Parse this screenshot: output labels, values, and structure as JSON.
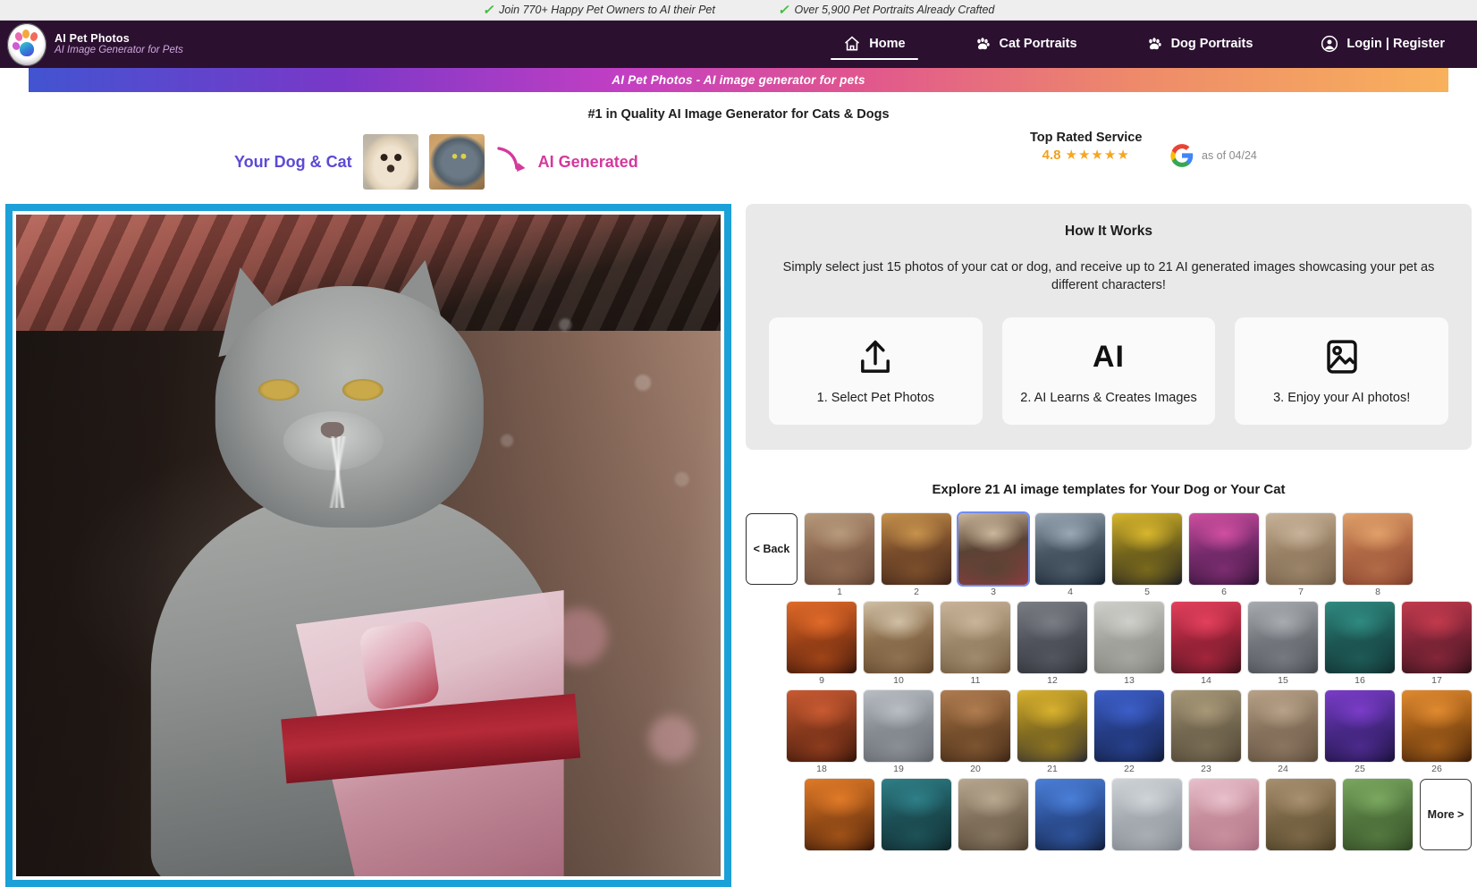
{
  "topbar": {
    "items": [
      "Join 770+ Happy Pet Owners to AI their Pet",
      "Over 5,900 Pet Portraits Already Crafted"
    ],
    "check_glyph": "✓"
  },
  "header": {
    "brand_title": "AI Pet Photos",
    "brand_subtitle": "AI Image Generator for Pets",
    "nav": [
      {
        "label": "Home",
        "icon": "home-icon",
        "active": true
      },
      {
        "label": "Cat Portraits",
        "icon": "paw-icon",
        "active": false
      },
      {
        "label": "Dog Portraits",
        "icon": "paw-icon",
        "active": false
      },
      {
        "label": "Login | Register",
        "icon": "user-icon",
        "active": false
      }
    ]
  },
  "banner": {
    "text": "AI Pet Photos - AI image generator for pets"
  },
  "subhead": {
    "text": "#1 in Quality AI Image Generator for Cats & Dogs"
  },
  "hero_strip": {
    "your_pets_label": "Your Dog & Cat",
    "ai_generated_label": "AI Generated",
    "arrow_icon": "curved-arrow-icon",
    "dog_thumb_name": "dog-photo-thumbnail",
    "cat_thumb_name": "cat-photo-thumbnail"
  },
  "rating": {
    "title": "Top Rated Service",
    "score": "4.8",
    "stars": "★★★★★",
    "as_of": "as of 04/24",
    "google_icon": "google-g-icon",
    "accent": "#f5a623"
  },
  "how_it_works": {
    "title": "How It Works",
    "description": "Simply select just 15 photos of your cat or dog, and receive up to 21 AI generated images showcasing your pet as different characters!",
    "steps": [
      {
        "label": "1. Select Pet Photos",
        "icon": "upload-icon"
      },
      {
        "label": "2. AI Learns & Creates Images",
        "icon": "ai-text-icon",
        "glyph": "AI"
      },
      {
        "label": "3. Enjoy your AI photos!",
        "icon": "image-icon"
      }
    ]
  },
  "gallery": {
    "title": "Explore 21 AI image templates for Your Dog or Your Cat",
    "back_label": "< Back",
    "more_label": "More >",
    "selected_index": 3,
    "rows": [
      {
        "lead": "back",
        "items": [
          {
            "n": "1",
            "c1": "#b79a7c",
            "c2": "#5d4030",
            "c3": "#8e6a52"
          },
          {
            "n": "2",
            "c1": "#c6924c",
            "c2": "#3a2118",
            "c3": "#7c4f2c"
          },
          {
            "n": "3",
            "c1": "#cbb79c",
            "c2": "#8e3b3f",
            "c3": "#5a4334"
          },
          {
            "n": "4",
            "c1": "#9aa7b4",
            "c2": "#14202e",
            "c3": "#4c5a68"
          },
          {
            "n": "5",
            "c1": "#d8b62d",
            "c2": "#1b1b22",
            "c3": "#7a6a1c"
          },
          {
            "n": "6",
            "c1": "#d04fa0",
            "c2": "#2a1030",
            "c3": "#7c2d70"
          },
          {
            "n": "7",
            "c1": "#c8b39a",
            "c2": "#6c5944",
            "c3": "#9b8468"
          },
          {
            "n": "8",
            "c1": "#e0a06a",
            "c2": "#7c3a2a",
            "c3": "#b36b46"
          }
        ]
      },
      {
        "lead": "none",
        "items": [
          {
            "n": "9",
            "c1": "#e06a2a",
            "c2": "#331208",
            "c3": "#a04418"
          },
          {
            "n": "10",
            "c1": "#d0c0a6",
            "c2": "#5b4028",
            "c3": "#8f7250"
          },
          {
            "n": "11",
            "c1": "#c9b49a",
            "c2": "#6a5238",
            "c3": "#a08b6e"
          },
          {
            "n": "12",
            "c1": "#7a7d84",
            "c2": "#2a2c33",
            "c3": "#53565e"
          },
          {
            "n": "13",
            "c1": "#cfcfcb",
            "c2": "#7b7a74",
            "c3": "#a6a6a0"
          },
          {
            "n": "14",
            "c1": "#e3405c",
            "c2": "#3a1018",
            "c3": "#a3253c"
          },
          {
            "n": "15",
            "c1": "#a8acb0",
            "c2": "#43474c",
            "c3": "#767a80"
          },
          {
            "n": "16",
            "c1": "#2f8a80",
            "c2": "#0f2a2c",
            "c3": "#1e5a56"
          },
          {
            "n": "17",
            "c1": "#c23a4c",
            "c2": "#2c1016",
            "c3": "#84263a"
          }
        ]
      },
      {
        "lead": "none",
        "items": [
          {
            "n": "18",
            "c1": "#c85a32",
            "c2": "#341208",
            "c3": "#8d3c1e"
          },
          {
            "n": "19",
            "c1": "#b9bec4",
            "c2": "#5f6369",
            "c3": "#8a8f95"
          },
          {
            "n": "20",
            "c1": "#b07c50",
            "c2": "#3d2414",
            "c3": "#7c5430"
          },
          {
            "n": "21",
            "c1": "#d8b12e",
            "c2": "#2a2a32",
            "c3": "#8d7420"
          },
          {
            "n": "22",
            "c1": "#3c5ec8",
            "c2": "#101a38",
            "c3": "#27408c"
          },
          {
            "n": "23",
            "c1": "#a89878",
            "c2": "#4a4030",
            "c3": "#786c54"
          },
          {
            "n": "24",
            "c1": "#b8a288",
            "c2": "#5a4a38",
            "c3": "#8a7560"
          },
          {
            "n": "25",
            "c1": "#7a3cc8",
            "c2": "#181038",
            "c3": "#4c2a8c"
          },
          {
            "n": "26",
            "c1": "#e08a30",
            "c2": "#3a1c08",
            "c3": "#a05c18"
          }
        ]
      },
      {
        "lead": "none",
        "trail": "more",
        "items": [
          {
            "n": "",
            "c1": "#e07a28",
            "c2": "#331406",
            "c3": "#a05218"
          },
          {
            "n": "",
            "c1": "#2f7f88",
            "c2": "#0e2428",
            "c3": "#1d5258"
          },
          {
            "n": "",
            "c1": "#b9a890",
            "c2": "#4a3c2c",
            "c3": "#857560"
          },
          {
            "n": "",
            "c1": "#4a7fd8",
            "c2": "#101c38",
            "c3": "#2f549c"
          },
          {
            "n": "",
            "c1": "#cfd4d8",
            "c2": "#7d838a",
            "c3": "#a8aeb4"
          },
          {
            "n": "",
            "c1": "#e8c0cc",
            "c2": "#a86a80",
            "c3": "#c8909e"
          },
          {
            "n": "",
            "c1": "#a89070",
            "c2": "#44381f",
            "c3": "#7c6848"
          },
          {
            "n": "",
            "c1": "#7aa860",
            "c2": "#2c4420",
            "c3": "#547840"
          }
        ]
      }
    ]
  },
  "hero_image": {
    "name": "ai-generated-cat-kimono-portrait",
    "border_color": "#1ba0d8"
  }
}
